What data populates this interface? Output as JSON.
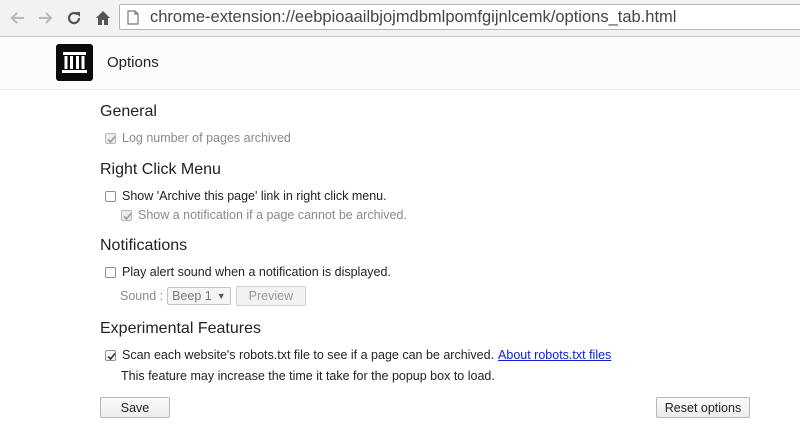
{
  "browser": {
    "url": "chrome-extension://eebpioaailbjojmdbmlpomfgijnlcemk/options_tab.html"
  },
  "header": {
    "title": "Options"
  },
  "general": {
    "title": "General",
    "log_pages": {
      "label": "Log number of pages archived",
      "checked": true,
      "disabled": true
    }
  },
  "right_click": {
    "title": "Right Click Menu",
    "show_link": {
      "label": "Show 'Archive this page' link in right click menu.",
      "checked": false
    },
    "show_notification": {
      "label": "Show a notification if a page cannot be archived.",
      "checked": true,
      "disabled": true
    }
  },
  "notifications": {
    "title": "Notifications",
    "play_sound": {
      "label": "Play alert sound when a notification is displayed.",
      "checked": false
    },
    "sound_label": "Sound :",
    "sound_value": "Beep 1",
    "preview_label": "Preview"
  },
  "experimental": {
    "title": "Experimental Features",
    "robots": {
      "label": "Scan each website's robots.txt file to see if a page can be archived.",
      "checked": true
    },
    "robots_link": "About robots.txt files",
    "note": "This feature may increase the time it take for the popup box to load."
  },
  "actions": {
    "save_label": "Save",
    "reset_label": "Reset options"
  }
}
